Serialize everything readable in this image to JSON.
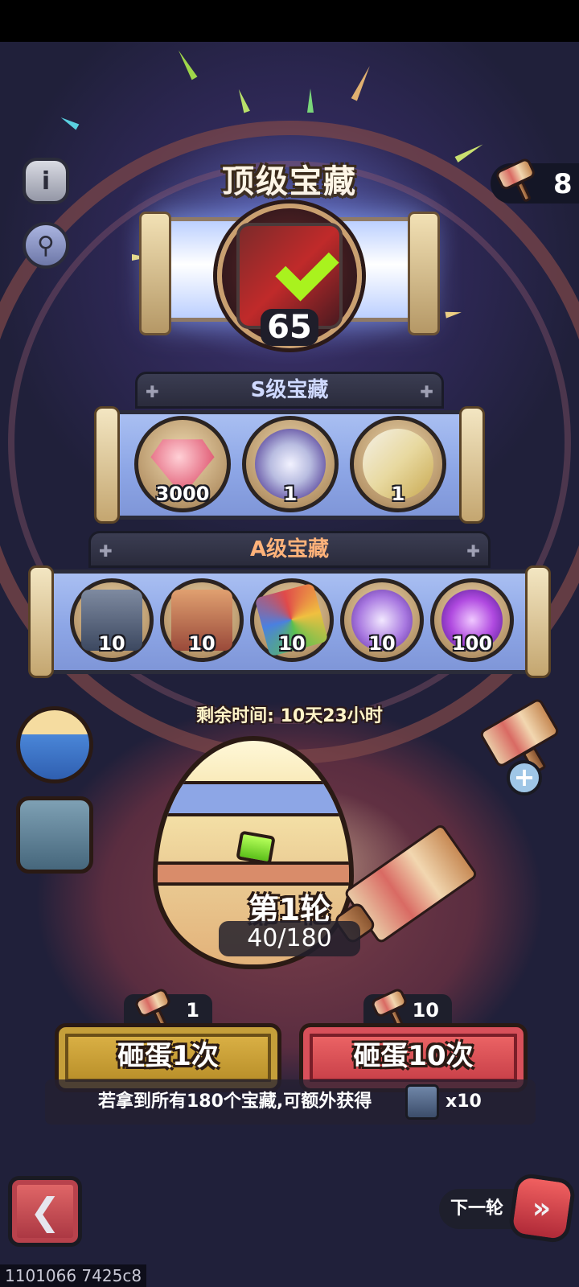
{
  "header": {
    "title": "顶级宝藏",
    "hammer_count": "8"
  },
  "top_prize": {
    "count": "65",
    "status": "claimed"
  },
  "tiers": {
    "s": {
      "label": "S级宝藏",
      "items": [
        {
          "icon": "gem-icon",
          "qty": "3000"
        },
        {
          "icon": "emblem-icon",
          "qty": "1"
        },
        {
          "icon": "ssr-dice-icon",
          "qty": "1"
        }
      ]
    },
    "a": {
      "label": "A级宝藏",
      "items": [
        {
          "icon": "iron-helmet-book-icon",
          "qty": "10"
        },
        {
          "icon": "gold-helmet-book-icon",
          "qty": "10"
        },
        {
          "icon": "colorful-scroll-icon",
          "qty": "10"
        },
        {
          "icon": "purple-crystal-icon",
          "qty": "10"
        },
        {
          "icon": "purple-emblem-icon",
          "qty": "100"
        }
      ]
    }
  },
  "timer": {
    "text": "剩余时间: 10天23小时"
  },
  "egg": {
    "round_label": "第1轮",
    "progress_text": "40/180"
  },
  "actions": {
    "smash_once": {
      "label": "砸蛋1次",
      "cost": "1"
    },
    "smash_ten": {
      "label": "砸蛋10次",
      "cost": "10"
    }
  },
  "reward_note": {
    "text": "若拿到所有180个宝藏,可额外获得",
    "bonus_qty": "x10",
    "bonus_icon": "helmet-book-icon"
  },
  "footer": {
    "next_round_label": "下一轮",
    "build_id": "1101066 7425c8"
  },
  "colors": {
    "accent_gold": "#e0b64a",
    "accent_red": "#e04c58",
    "panel_blue": "#8da6e6",
    "check_green": "#a9f21e"
  }
}
